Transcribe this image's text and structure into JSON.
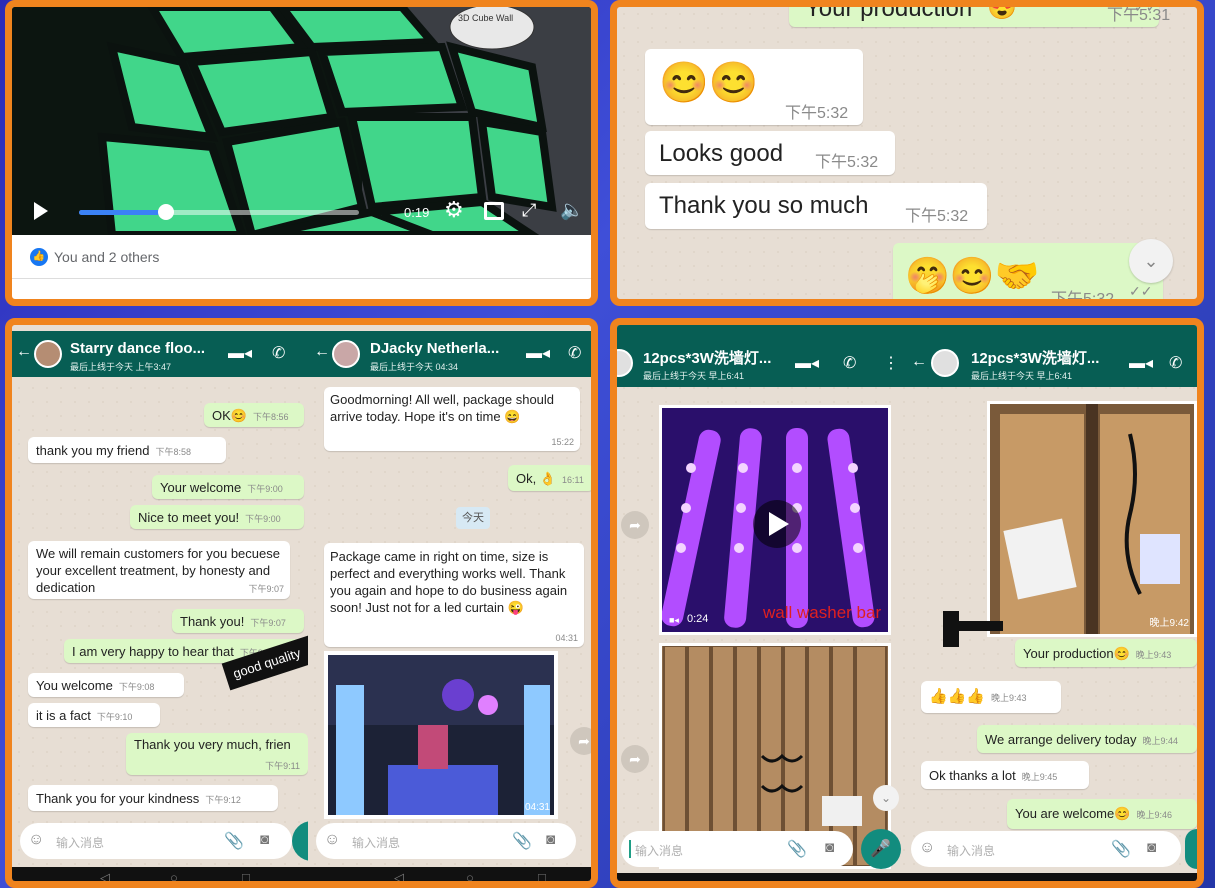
{
  "video": {
    "caption": "3D Cube Wall",
    "time": "0:19",
    "reactions": "You and 2 others",
    "progress": 0.31
  },
  "chat1": {
    "partial_text": "Your production",
    "partial_emoji": "😍",
    "partial_time": "下午5:31",
    "messages": [
      {
        "text": "😊😊",
        "time": "下午5:32"
      },
      {
        "text": "Looks good",
        "time": "下午5:32"
      },
      {
        "text": "Thank you so much",
        "time": "下午5:32"
      },
      {
        "text": "🤭😊🤝",
        "time": "下午5:32"
      }
    ]
  },
  "chat2": {
    "name": "Starry dance floo...",
    "status": "最后上线于今天 上午3:47",
    "input_placeholder": "输入消息",
    "messages": [
      {
        "text": "OK😊",
        "time": "下午8:56"
      },
      {
        "text": "thank you my friend",
        "time": "下午8:58"
      },
      {
        "text": "Your welcome",
        "time": "下午9:00"
      },
      {
        "text": "Nice to meet you!",
        "time": "下午9:00"
      },
      {
        "text": "We will remain customers for you becuese your excellent treatment, by honesty and dedication",
        "time": "下午9:07"
      },
      {
        "text": "Thank you!",
        "time": "下午9:07"
      },
      {
        "text": "I am very happy to hear that",
        "time": "下午9:07"
      },
      {
        "text": "You welcome",
        "time": "下午9:08"
      },
      {
        "text": "it is a fact",
        "time": "下午9:10"
      },
      {
        "text": "Thank you very much, frien",
        "time": "下午9:11"
      },
      {
        "text": "Thank you for your kindness",
        "time": "下午9:12"
      }
    ],
    "annotation": "good quality"
  },
  "chat3": {
    "name": "DJacky Netherla...",
    "status": "最后上线于今天 04:34",
    "input_placeholder": "输入消息",
    "date_chip": "今天",
    "messages": [
      {
        "text": "Goodmorning! All well, package should arrive today. Hope it's on time 😄",
        "time": "15:22"
      },
      {
        "text": "Ok, 👌",
        "time": "16:11"
      },
      {
        "text": "Package came in right on time, size is perfect and everything works well. Thank you again and hope to do business again soon! Just not for a led curtain 😜",
        "time": "04:31"
      }
    ],
    "photo_time": "04:31"
  },
  "chat4": {
    "name": "12pcs*3W洗墙灯...",
    "status": "最后上线于今天 早上6:41",
    "input_placeholder": "输入消息",
    "video_duration": "0:24",
    "red_label": "wall washer bar",
    "photo_time": "晚上9:42"
  },
  "chat5": {
    "name": "12pcs*3W洗墙灯...",
    "status": "最后上线于今天 早上6:41",
    "input_placeholder": "输入消息",
    "photo_time": "晚上9:42",
    "messages": [
      {
        "text": "Your production😊",
        "time": "晚上9:43"
      },
      {
        "text": "👍👍👍",
        "time": "晚上9:43"
      },
      {
        "text": "We arrange delivery today",
        "time": "晚上9:44"
      },
      {
        "text": "Ok thanks a lot",
        "time": "晚上9:45"
      },
      {
        "text": "You are welcome😊",
        "time": "晚上9:46"
      }
    ]
  },
  "colors": {
    "frame": "#f0841e",
    "header": "#075e54",
    "outgoing": "#dcf8c6",
    "incoming": "#ffffff"
  }
}
